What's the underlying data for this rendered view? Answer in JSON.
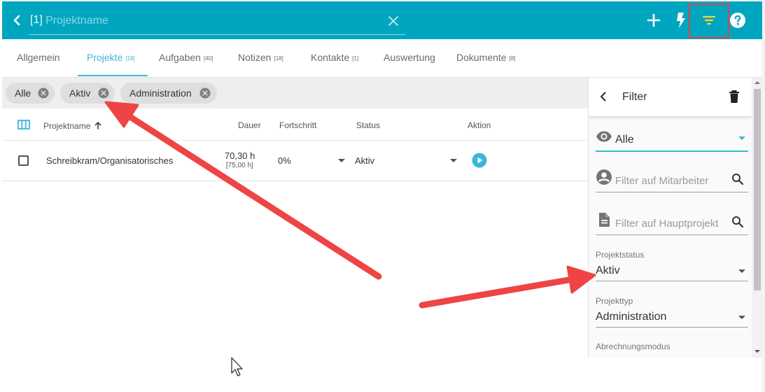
{
  "colors": {
    "topbar": "#00a6bf",
    "accent": "#3cb6d8",
    "play": "#3cb6d8",
    "filter_icon": "#f5d33c",
    "highlight": "#d9454e",
    "arrow": "#ef4444"
  },
  "header": {
    "title_prefix": "[1]",
    "title_placeholder": "Projektname",
    "icons": [
      "back-icon",
      "close-icon",
      "plus-icon",
      "bolt-icon",
      "filter-icon",
      "help-icon"
    ]
  },
  "tabs": [
    {
      "label": "Allgemein",
      "count": ""
    },
    {
      "label": "Projekte",
      "count": "[19]",
      "active": true
    },
    {
      "label": "Aufgaben",
      "count": "[40]"
    },
    {
      "label": "Notizen",
      "count": "[18]"
    },
    {
      "label": "Kontakte",
      "count": "[1]"
    },
    {
      "label": "Auswertung",
      "count": ""
    },
    {
      "label": "Dokumente",
      "count": "[8]"
    }
  ],
  "chips": [
    {
      "label": "Alle"
    },
    {
      "label": "Aktiv"
    },
    {
      "label": "Administration"
    }
  ],
  "table": {
    "headers": {
      "name": "Projektname",
      "duration": "Dauer",
      "progress": "Fortschritt",
      "status": "Status",
      "action": "Aktion"
    },
    "rows": [
      {
        "name": "Schreibkram/Organisatorisches",
        "duration": "70,30 h",
        "duration_planned": "[75,00 h]",
        "progress": "0%",
        "status": "Aktiv"
      }
    ]
  },
  "filter_panel": {
    "title": "Filter",
    "visibility_value": "Alle",
    "employee_placeholder": "Filter auf Mitarbeiter",
    "main_project_placeholder": "Filter auf Hauptprojekt",
    "status_label": "Projektstatus",
    "status_value": "Aktiv",
    "type_label": "Projekttyp",
    "type_value": "Administration",
    "billing_label": "Abrechnungsmodus"
  }
}
